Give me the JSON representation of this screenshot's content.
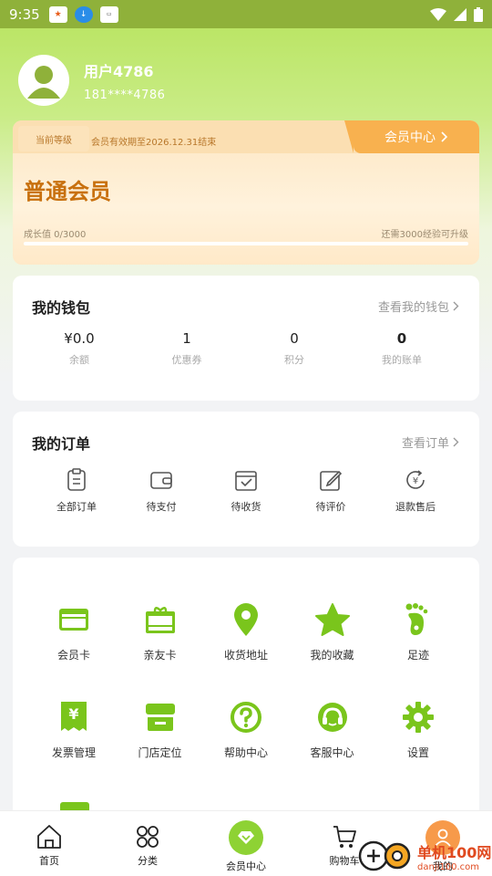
{
  "status_bar": {
    "time": "9:35"
  },
  "profile": {
    "username": "用户4786",
    "phone": "181****4786"
  },
  "membership": {
    "level_tag": "当前等级",
    "expiry": "会员有效期至2026.12.31结束",
    "center_link": "会员中心",
    "level": "普通会员",
    "growth_label": "成长值 0/3000",
    "growth_remaining": "还需3000经验可升级",
    "growth_progress": 0,
    "accent_color": "#f8b14f"
  },
  "wallet": {
    "title": "我的钱包",
    "link": "查看我的钱包",
    "items": [
      {
        "value": "¥0.0",
        "label": "余额"
      },
      {
        "value": "1",
        "label": "优惠券"
      },
      {
        "value": "0",
        "label": "积分"
      },
      {
        "value": "0",
        "label": "我的账单"
      }
    ]
  },
  "orders": {
    "title": "我的订单",
    "link": "查看订单",
    "items": [
      {
        "icon": "clipboard-icon",
        "label": "全部订单"
      },
      {
        "icon": "wallet-icon",
        "label": "待支付"
      },
      {
        "icon": "box-check-icon",
        "label": "待收货"
      },
      {
        "icon": "edit-icon",
        "label": "待评价"
      },
      {
        "icon": "refund-icon",
        "label": "退款售后"
      }
    ]
  },
  "services": {
    "accent_color": "#7ac51c",
    "items": [
      {
        "icon": "card-icon",
        "label": "会员卡"
      },
      {
        "icon": "gift-card-icon",
        "label": "亲友卡"
      },
      {
        "icon": "location-icon",
        "label": "收货地址"
      },
      {
        "icon": "star-icon",
        "label": "我的收藏"
      },
      {
        "icon": "footprint-icon",
        "label": "足迹"
      },
      {
        "icon": "invoice-icon",
        "label": "发票管理"
      },
      {
        "icon": "store-icon",
        "label": "门店定位"
      },
      {
        "icon": "help-icon",
        "label": "帮助中心"
      },
      {
        "icon": "support-icon",
        "label": "客服中心"
      },
      {
        "icon": "gear-icon",
        "label": "设置"
      }
    ]
  },
  "nav": {
    "items": [
      {
        "icon": "home-icon",
        "label": "首页"
      },
      {
        "icon": "category-icon",
        "label": "分类"
      },
      {
        "icon": "member-icon",
        "label": "会员中心"
      },
      {
        "icon": "cart-icon",
        "label": "购物车"
      },
      {
        "icon": "user-icon",
        "label": "我的"
      }
    ]
  },
  "watermark": {
    "text": "单机100网",
    "sub": "danji100.com"
  }
}
